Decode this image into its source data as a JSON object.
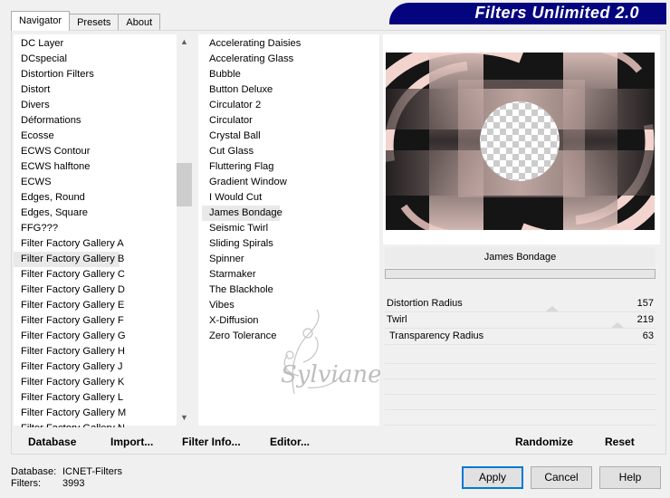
{
  "tabs": [
    "Navigator",
    "Presets",
    "About"
  ],
  "banner": "Filters Unlimited 2.0",
  "categories": [
    "DC Layer",
    "DCspecial",
    "Distortion Filters",
    "Distort",
    "Divers",
    "Déformations",
    "Ecosse",
    "ECWS Contour",
    "ECWS halftone",
    "ECWS",
    "Edges, Round",
    "Edges, Square",
    "FFG???",
    "Filter Factory Gallery A",
    "Filter Factory Gallery B",
    "Filter Factory Gallery C",
    "Filter Factory Gallery D",
    "Filter Factory Gallery E",
    "Filter Factory Gallery F",
    "Filter Factory Gallery G",
    "Filter Factory Gallery H",
    "Filter Factory Gallery J",
    "Filter Factory Gallery K",
    "Filter Factory Gallery L",
    "Filter Factory Gallery M",
    "Filter Factory Gallery N"
  ],
  "selected_category": "Filter Factory Gallery B",
  "filters": [
    "Accelerating Daisies",
    "Accelerating Glass",
    "Bubble",
    "Button Deluxe",
    "Circulator 2",
    "Circulator",
    "Crystal Ball",
    "Cut Glass",
    "Fluttering Flag",
    "Gradient Window",
    "I Would Cut",
    "James Bondage",
    "Seismic Twirl",
    "Sliding Spirals",
    "Spinner",
    "Starmaker",
    "The Blackhole",
    "Vibes",
    "X-Diffusion",
    "Zero Tolerance"
  ],
  "selected_filter": "James Bondage",
  "watermark": "Sylviane",
  "filter_title": "James Bondage",
  "params": [
    {
      "label": "Distortion Radius",
      "value": "157"
    },
    {
      "label": "Twirl",
      "value": "219"
    },
    {
      "label": "Transparency Radius",
      "value": "63"
    }
  ],
  "buttons": {
    "database": "Database",
    "import": "Import...",
    "filter_info": "Filter Info...",
    "editor": "Editor...",
    "randomize": "Randomize",
    "reset": "Reset",
    "apply": "Apply",
    "cancel": "Cancel",
    "help": "Help"
  },
  "status": {
    "database_label": "Database:",
    "database_value": "ICNET-Filters",
    "filters_label": "Filters:",
    "filters_value": "3993"
  },
  "colors": {
    "banner": "#04047e",
    "preview_pink": "#f2d3cd",
    "preview_dark": "#151515"
  }
}
